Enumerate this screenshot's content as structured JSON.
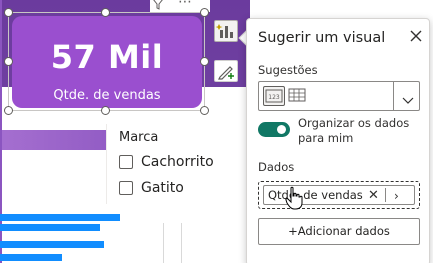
{
  "card": {
    "value": "57 Mil",
    "label": "Qtde. de vendas",
    "background": "#9a4fcf"
  },
  "slicer": {
    "title": "Marca",
    "items": [
      {
        "label": "Cachorrito",
        "checked": false
      },
      {
        "label": "Gatito",
        "checked": false
      }
    ]
  },
  "header_icons": [
    "filter-icon",
    "more-options-icon"
  ],
  "visual_toolbar": [
    "suggest-visual-icon",
    "format-visual-icon"
  ],
  "suggest_pane": {
    "title": "Sugerir um visual",
    "suggestions_label": "Sugestões",
    "suggestion_options": [
      "card-visual-icon",
      "table-visual-icon"
    ],
    "selected_option": "card-visual-icon",
    "toggle": {
      "on": true,
      "label": "Organizar os dados para mim"
    },
    "data_label": "Dados",
    "fields": [
      {
        "label": "Qtde. de vendas"
      }
    ],
    "add_button": "+Adicionar dados"
  },
  "colors": {
    "accent_purple": "#6e3fa0",
    "toggle_on": "#117865",
    "bar_blue": "#118dff"
  }
}
